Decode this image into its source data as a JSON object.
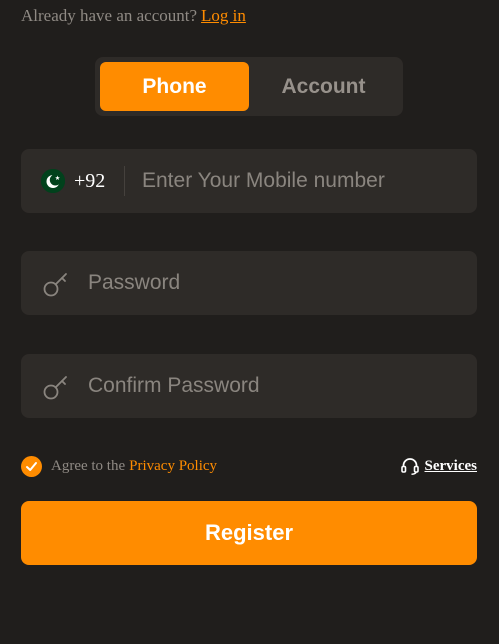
{
  "header": {
    "prompt_text": "Already have an account?",
    "login_link": "Log in"
  },
  "tabs": [
    {
      "label": "Phone",
      "active": true
    },
    {
      "label": "Account",
      "active": false
    }
  ],
  "form": {
    "phone": {
      "country_flag": "pakistan-flag-icon",
      "country_code": "+92",
      "placeholder": "Enter Your Mobile number",
      "value": ""
    },
    "password": {
      "icon": "key-icon",
      "placeholder": "Password",
      "value": ""
    },
    "confirm_password": {
      "icon": "key-icon",
      "placeholder": "Confirm Password",
      "value": ""
    }
  },
  "agreement": {
    "checked": true,
    "text": "Agree to the",
    "link": "Privacy Policy"
  },
  "services": {
    "icon": "headset-icon",
    "label": "Services"
  },
  "register_button": "Register",
  "colors": {
    "background": "#201e1c",
    "panel": "#2e2b28",
    "accent": "#ff8c00",
    "muted_text": "#8f8a84"
  }
}
